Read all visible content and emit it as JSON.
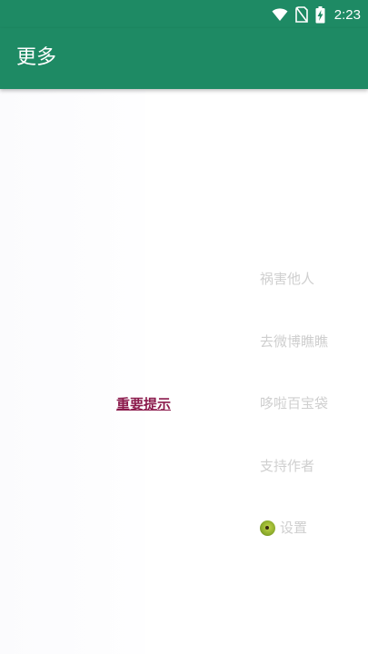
{
  "status_bar": {
    "time": "2:23",
    "icons": [
      "wifi-icon",
      "no-sim-icon",
      "battery-charging-icon"
    ],
    "background": "#1e8a64"
  },
  "app_bar": {
    "title": "更多",
    "background": "#1e8a64"
  },
  "content": {
    "important_link": "重要提示",
    "menu": [
      {
        "label": "祸害他人"
      },
      {
        "label": "去微博瞧瞧"
      },
      {
        "label": "哆啦百宝袋"
      },
      {
        "label": "支持作者"
      },
      {
        "label": "设置",
        "icon": "kiwi-settings-icon"
      }
    ]
  },
  "colors": {
    "link": "#8b1a4c",
    "menu_text": "#cfcfcf"
  }
}
